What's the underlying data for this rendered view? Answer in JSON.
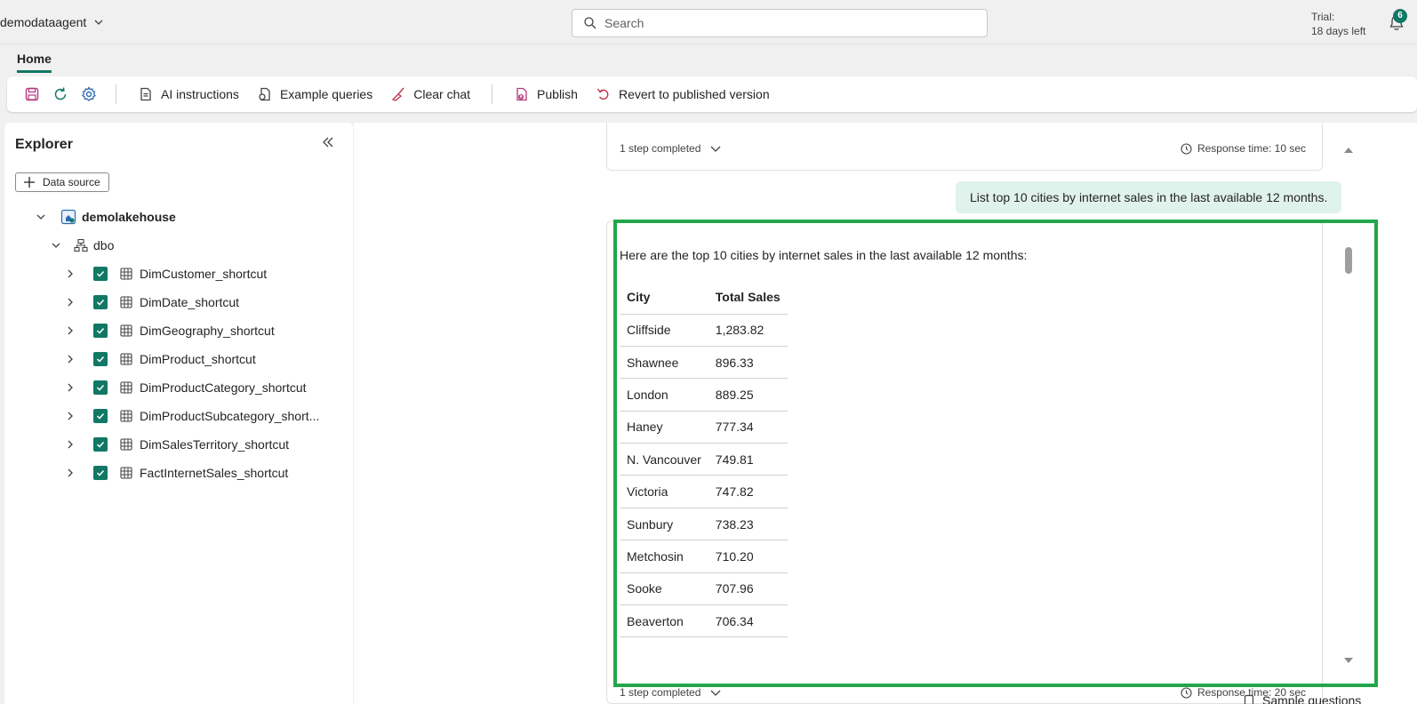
{
  "workspace": {
    "name": "demodataagent"
  },
  "search": {
    "placeholder": "Search"
  },
  "trial": {
    "line1": "Trial:",
    "line2": "18 days left"
  },
  "notifications": {
    "count": "6"
  },
  "tabs": {
    "home": "Home"
  },
  "toolbar": {
    "ai_instructions": "AI instructions",
    "example_queries": "Example queries",
    "clear_chat": "Clear chat",
    "publish": "Publish",
    "revert": "Revert to published version"
  },
  "explorer": {
    "title": "Explorer",
    "data_source_button": "Data source",
    "lakehouse": "demolakehouse",
    "schema": "dbo",
    "tables": [
      "DimCustomer_shortcut",
      "DimDate_shortcut",
      "DimGeography_shortcut",
      "DimProduct_shortcut",
      "DimProductCategory_shortcut",
      "DimProductSubcategory_short...",
      "DimSalesTerritory_shortcut",
      "FactInternetSales_shortcut"
    ]
  },
  "chat": {
    "prev_step": "1 step completed",
    "prev_response_time": "Response time: 10 sec",
    "user_message": "List top 10 cities by internet sales in the last available 12 months.",
    "answer_intro": "Here are the top 10 cities by internet sales in the last available 12 months:",
    "table": {
      "headers": [
        "City",
        "Total Sales"
      ],
      "rows": [
        [
          "Cliffside",
          "1,283.82"
        ],
        [
          "Shawnee",
          "896.33"
        ],
        [
          "London",
          "889.25"
        ],
        [
          "Haney",
          "777.34"
        ],
        [
          "N. Vancouver",
          "749.81"
        ],
        [
          "Victoria",
          "747.82"
        ],
        [
          "Sunbury",
          "738.23"
        ],
        [
          "Metchosin",
          "710.20"
        ],
        [
          "Sooke",
          "707.96"
        ],
        [
          "Beaverton",
          "706.34"
        ]
      ]
    },
    "answer_step": "1 step completed",
    "answer_response_time": "Response time: 20 sec",
    "sample_questions": "Sample questions"
  },
  "colors": {
    "accent": "#117865",
    "highlight": "#22a64a",
    "user_bubble": "#e0f2ec"
  }
}
